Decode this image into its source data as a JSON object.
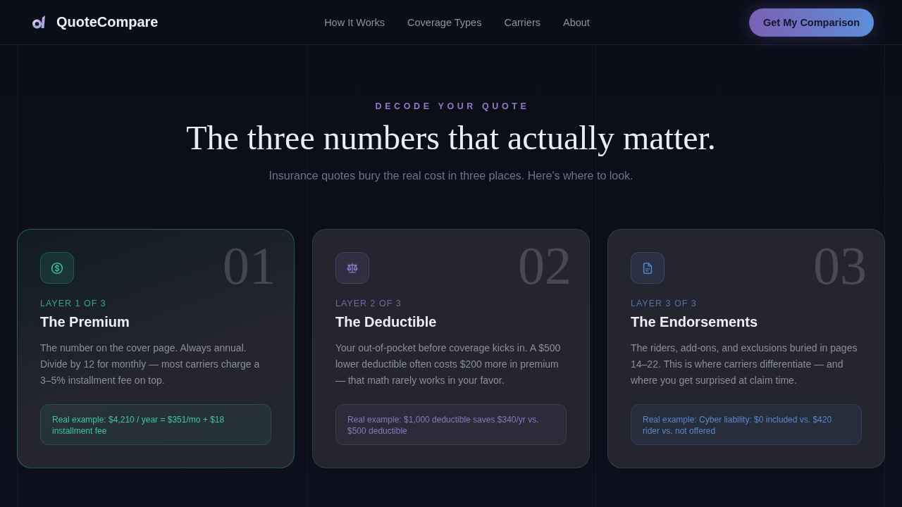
{
  "header": {
    "brand": "QuoteCompare",
    "nav": [
      "How It Works",
      "Coverage Types",
      "Carriers",
      "About"
    ],
    "cta": "Get My Comparison"
  },
  "hero": {
    "eyebrow": "DECODE YOUR QUOTE",
    "title": "The three numbers that actually matter.",
    "subtitle": "Insurance quotes bury the real cost in three places. Here's where to look."
  },
  "cards": [
    {
      "number": "01",
      "layer": "LAYER 1 OF 3",
      "title": "The Premium",
      "body": "The number on the cover page. Always annual. Divide by 12 for monthly — most carriers charge a 3–5% installment fee on top.",
      "example": "Real example: $4,210 / year = $351/mo + $18 installment fee",
      "color": "#3ec4a6",
      "highlighted": true
    },
    {
      "number": "02",
      "layer": "LAYER 2 OF 3",
      "title": "The Deductible",
      "body": "Your out-of-pocket before coverage kicks in. A $500 lower deductible often costs $200 more in premium — that math rarely works in your favor.",
      "example": "Real example: $1,000 deductible saves $340/yr vs. $500 deductible",
      "color": "#8c76bd",
      "highlighted": false
    },
    {
      "number": "03",
      "layer": "LAYER 3 OF 3",
      "title": "The Endorsements",
      "body": "The riders, add-ons, and exclusions buried in pages 14–22. This is where carriers differentiate — and where you get surprised at claim time.",
      "example": "Real example: Cyber liability: $0 included vs. $420 rider vs. not offered",
      "color": "#5b86cc",
      "highlighted": false
    }
  ]
}
